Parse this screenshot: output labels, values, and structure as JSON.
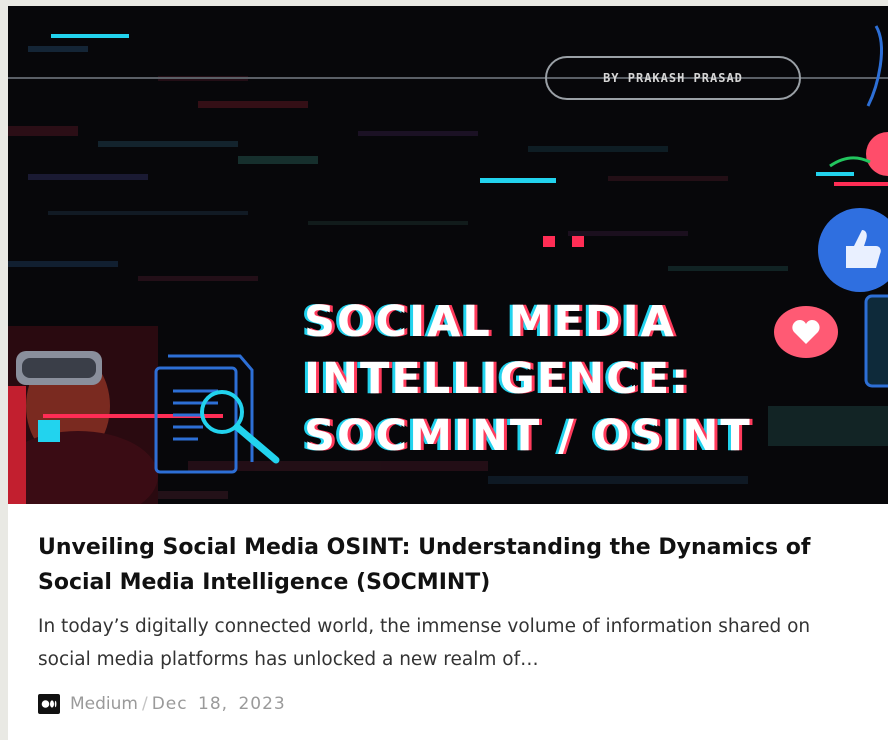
{
  "card": {
    "image": {
      "byline": "BY PRAKASH PRASAD",
      "headline_lines": [
        "SOCIAL MEDIA",
        "INTELLIGENCE:",
        "SOCMINT / OSINT"
      ],
      "colors": {
        "background": "#07070a",
        "cyan_accent": "#22d3ee",
        "red_accent": "#ff2d55"
      }
    },
    "title": "Unveiling Social Media OSINT: Understanding the Dynamics of Social Media Intelligence (SOCMINT)",
    "excerpt": "In today’s digitally connected world, the immense volume of information shared on social media platforms has unlocked a new realm of…",
    "meta": {
      "source_icon": "medium-logo-icon",
      "source": "Medium",
      "separator": "/",
      "date": "Dec 18, 2023"
    }
  }
}
